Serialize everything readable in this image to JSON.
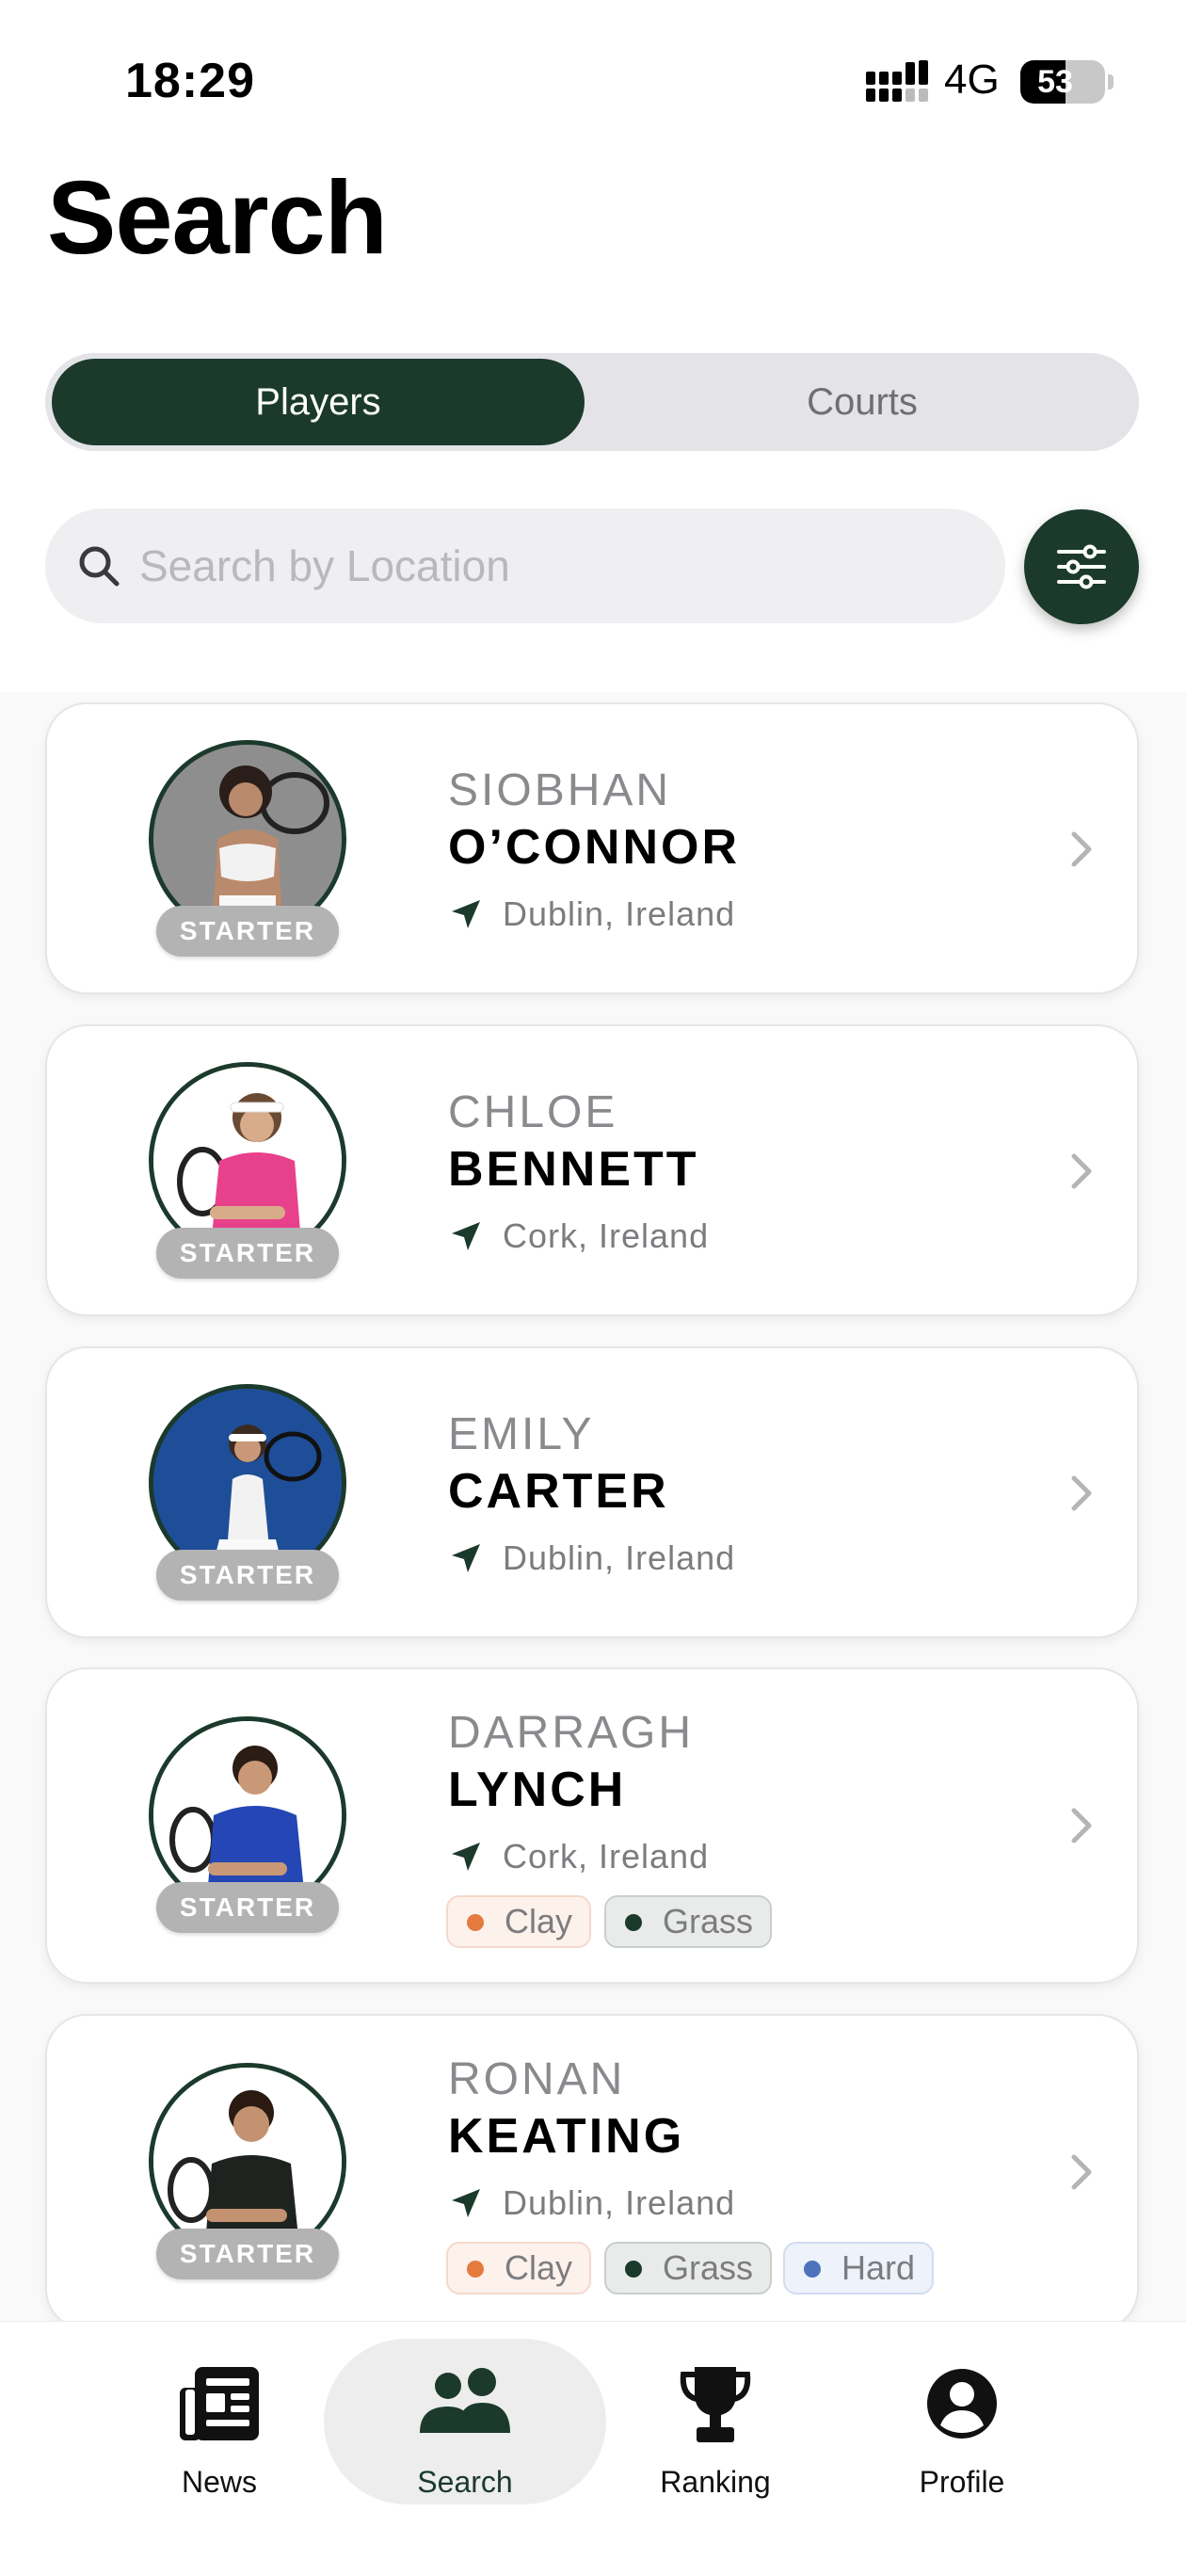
{
  "status_bar": {
    "time": "18:29",
    "network": "4G",
    "battery": "53",
    "battery_level": 0.53
  },
  "page": {
    "title": "Search"
  },
  "segmented": {
    "players": "Players",
    "courts": "Courts",
    "selected": "Players"
  },
  "search": {
    "placeholder": "Search by Location",
    "value": ""
  },
  "colors": {
    "accent": "#1b3a2c",
    "clay": "#e57a3e",
    "grass": "#1b3a2c",
    "hard": "#4e73bd",
    "badge": "#b3b3b3"
  },
  "players": [
    {
      "first_name": "SIOBHAN",
      "last_name": "O’CONNOR",
      "location": "Dublin, Ireland",
      "level": "STARTER",
      "surfaces": []
    },
    {
      "first_name": "CHLOE",
      "last_name": "BENNETT",
      "location": "Cork, Ireland",
      "level": "STARTER",
      "surfaces": []
    },
    {
      "first_name": "EMILY",
      "last_name": "CARTER",
      "location": "Dublin, Ireland",
      "level": "STARTER",
      "surfaces": []
    },
    {
      "first_name": "DARRAGH",
      "last_name": "LYNCH",
      "location": "Cork, Ireland",
      "level": "STARTER",
      "surfaces": [
        "Clay",
        "Grass"
      ]
    },
    {
      "first_name": "RONAN",
      "last_name": "KEATING",
      "location": "Dublin, Ireland",
      "level": "STARTER",
      "surfaces": [
        "Clay",
        "Grass",
        "Hard"
      ]
    }
  ],
  "tab_bar": {
    "news": "News",
    "search": "Search",
    "ranking": "Ranking",
    "profile": "Profile",
    "selected": "Search"
  }
}
